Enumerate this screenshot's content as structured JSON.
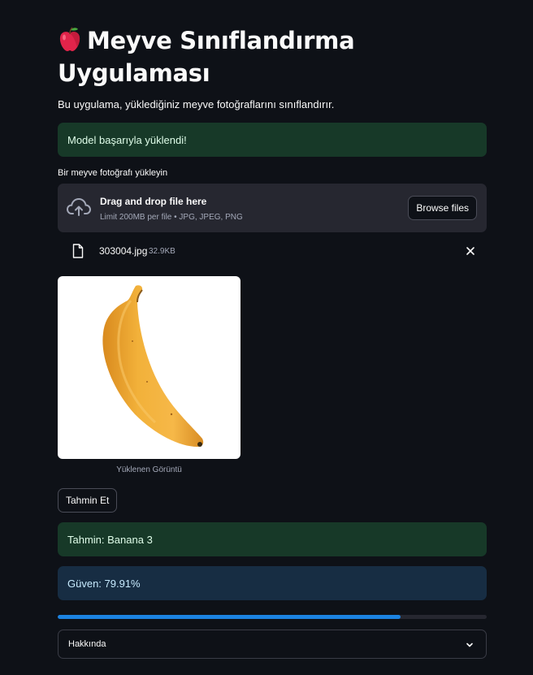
{
  "app": {
    "title_icon": "red-apple-icon",
    "title": "Meyve Sınıflandırma Uygulaması",
    "subtitle": "Bu uygulama, yüklediğiniz meyve fotoğraflarını sınıflandırır."
  },
  "status": {
    "model_loaded": "Model başarıyla yüklendi!"
  },
  "uploader": {
    "label": "Bir meyve fotoğrafı yükleyin",
    "drag_text": "Drag and drop file here",
    "limit_text": "Limit 200MB per file • JPG, JPEG, PNG",
    "browse_label": "Browse files",
    "file": {
      "name": "303004.jpg",
      "size": "32.9KB"
    }
  },
  "image": {
    "caption": "Yüklenen Görüntü",
    "subject": "banana"
  },
  "actions": {
    "predict_label": "Tahmin Et"
  },
  "results": {
    "prediction": "Tahmin: Banana 3",
    "confidence": "Güven: 79.91%",
    "confidence_value": 0.7991
  },
  "expander": {
    "label": "Hakkında"
  },
  "colors": {
    "background": "#0e1117",
    "success_bg": "#173928",
    "info_bg": "#172d43",
    "progress": "#1c83e1"
  }
}
